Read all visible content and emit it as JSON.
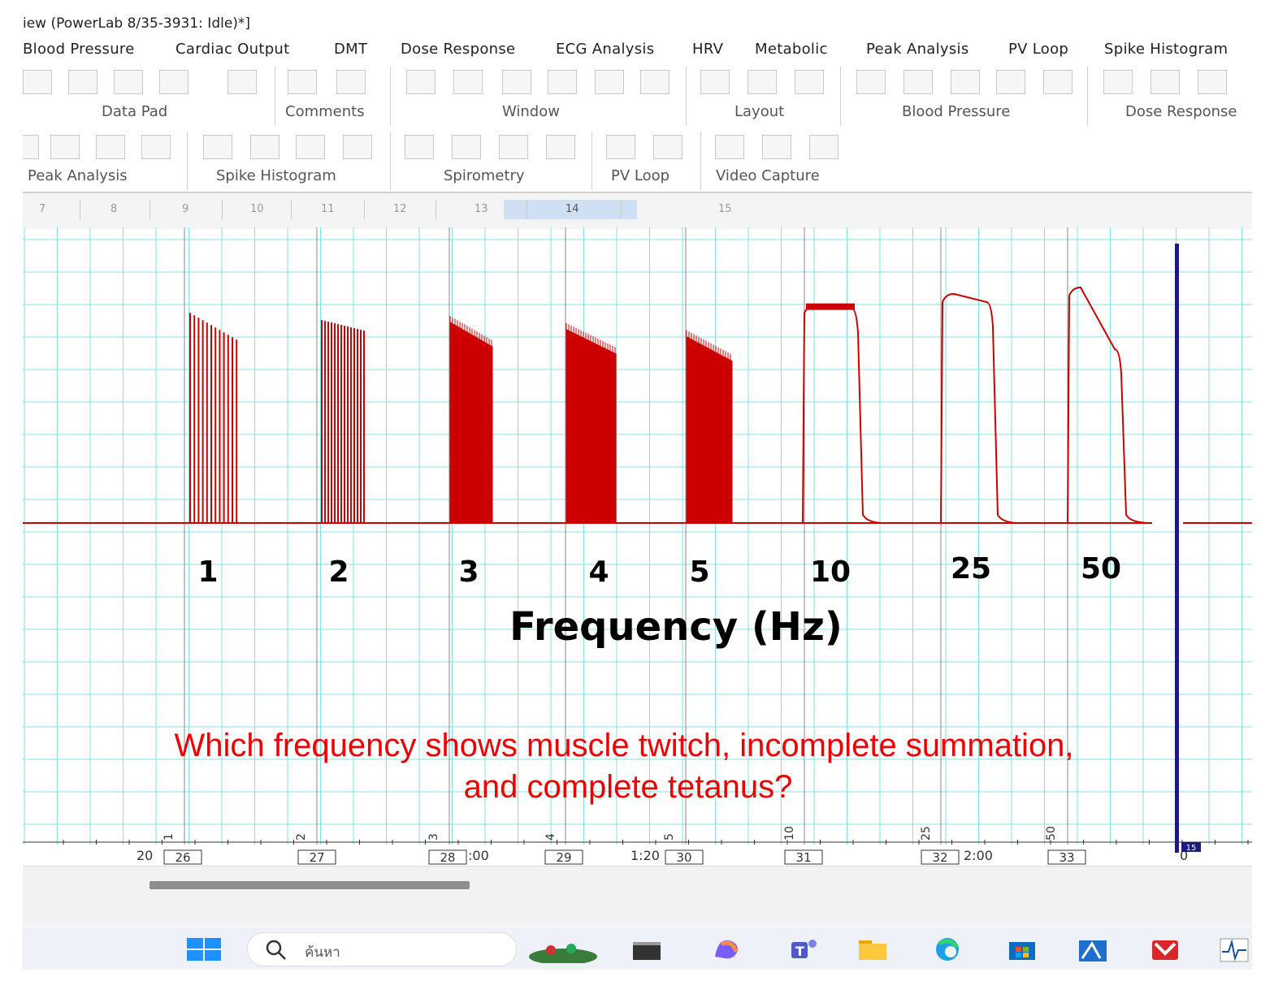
{
  "window": {
    "title": "iew (PowerLab 8/35-3931: Idle)*]"
  },
  "menu": [
    "Blood Pressure",
    "Cardiac Output",
    "DMT",
    "Dose Response",
    "ECG Analysis",
    "HRV",
    "Metabolic",
    "Peak Analysis",
    "PV Loop",
    "Spike Histogram"
  ],
  "toolbar_groups_row1": [
    "Data Pad",
    "Comments",
    "Window",
    "Layout",
    "Blood Pressure",
    "Dose Response"
  ],
  "toolbar_groups_row2": [
    "Peak Analysis",
    "Spike Histogram",
    "Spirometry",
    "PV Loop",
    "Video Capture"
  ],
  "ruler": {
    "labels": [
      "7",
      "8",
      "9",
      "10",
      "11",
      "12",
      "13",
      "14",
      "15"
    ],
    "selected": "14"
  },
  "chart": {
    "frequency_labels": [
      "1",
      "2",
      "3",
      "4",
      "5",
      "10",
      "25",
      "50"
    ],
    "axis_title": "Frequency (Hz)",
    "question_line1": "Which frequency shows muscle twitch, incomplete summation,",
    "question_line2": "and complete tetanus?",
    "trace_color": "#cc0000",
    "grid_color": "#7fe3e3",
    "cursor_color": "#1a1a80"
  },
  "chart_data": {
    "type": "line",
    "x_label": "Frequency (Hz)",
    "series": [
      {
        "stimulus_hz": 1,
        "peak_level": 0.88,
        "pattern": "separate twitches"
      },
      {
        "stimulus_hz": 2,
        "peak_level": 0.85,
        "pattern": "separate twitches"
      },
      {
        "stimulus_hz": 3,
        "peak_level": 0.84,
        "pattern": "partial fusion"
      },
      {
        "stimulus_hz": 4,
        "peak_level": 0.81,
        "pattern": "incomplete summation"
      },
      {
        "stimulus_hz": 5,
        "peak_level": 0.78,
        "pattern": "incomplete summation"
      },
      {
        "stimulus_hz": 10,
        "peak_level": 0.94,
        "pattern": "near-fused tetanus"
      },
      {
        "stimulus_hz": 25,
        "peak_level": 0.98,
        "pattern": "complete tetanus"
      },
      {
        "stimulus_hz": 50,
        "peak_level": 1.0,
        "pattern": "complete tetanus with fatigue"
      }
    ]
  },
  "time_axis": {
    "channel_marks": [
      "1",
      "2",
      "3",
      "4",
      "5",
      "10",
      "25",
      "50"
    ],
    "boxes": [
      "26",
      "27",
      "28",
      "29",
      "30",
      "31",
      "32",
      "33"
    ],
    "time_labels": [
      "20",
      ":00",
      "1:20",
      "2:00",
      "0"
    ],
    "cursor_box": "15"
  },
  "taskbar": {
    "search_placeholder": "ค้นหา",
    "icons": [
      "windows-start-icon",
      "search-icon",
      "widgets-icon",
      "task-view-icon",
      "copilot-icon",
      "teams-icon",
      "file-explorer-icon",
      "edge-icon",
      "store-icon",
      "labchart-icon",
      "mail-icon",
      "powerlab-icon"
    ]
  }
}
